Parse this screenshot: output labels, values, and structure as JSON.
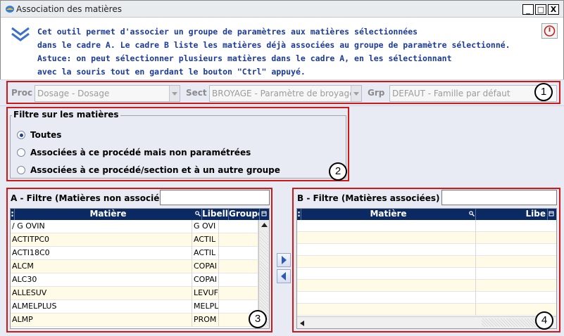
{
  "window": {
    "title": "Association des matières",
    "minimize": "_",
    "maximize": "□",
    "close": "X"
  },
  "info": {
    "lines": [
      "Cet outil permet d'associer un groupe de paramètres aux matières sélectionnées",
      "dans le cadre A. Le cadre B liste les matières déjà associées au groupe de paramètre sélectionné.",
      "Astuce: on peut sélectionner plusieurs matières dans le cadre A, en les sélectionnant",
      "avec la souris tout en gardant le bouton \"Ctrl\" appuyé."
    ]
  },
  "filterbar": {
    "proc_label": "Proc",
    "proc_value": "Dosage - Dosage",
    "sect_label": "Sect",
    "sect_value": "BROYAGE - Paramètre de broyage",
    "grp_label": "Grp",
    "grp_value": "DEFAUT - Famille par défaut",
    "marker": "1"
  },
  "filter_section": {
    "legend": "Filtre sur les matières",
    "options": [
      {
        "label": "Toutes",
        "checked": true
      },
      {
        "label": "Associées à ce procédé mais non paramétrées",
        "checked": false
      },
      {
        "label": "Associées à ce procédé/section et à un autre groupe",
        "checked": false
      }
    ],
    "marker": "2"
  },
  "panel_a": {
    "title": "A - Filtre (Matières non associées)",
    "filter_value": "",
    "columns": [
      "Matière",
      "Libell",
      "Groupe"
    ],
    "rows": [
      {
        "matiere": "/ G OVIN",
        "libelle": "G OVI"
      },
      {
        "matiere": "ACTITPC0",
        "libelle": "ACTIL"
      },
      {
        "matiere": "ACTI18C0",
        "libelle": "ACTIL"
      },
      {
        "matiere": "ALCM",
        "libelle": "COPAI"
      },
      {
        "matiere": "ALC30",
        "libelle": "COPAI"
      },
      {
        "matiere": "ALLESUV",
        "libelle": "LEVUF"
      },
      {
        "matiere": "ALMELPLUS",
        "libelle": "MELPL"
      },
      {
        "matiere": "ALMP",
        "libelle": "PROM"
      }
    ],
    "marker": "3"
  },
  "panel_b": {
    "title": "B - Filtre (Matières associées)",
    "filter_value": "",
    "columns": [
      "Matière",
      "Libe"
    ],
    "row_count": 8,
    "marker": "4"
  },
  "colors": {
    "header_bg": "#0b2a63",
    "info_text": "#1b3a9c",
    "marker_border": "#d01818",
    "row_alt": "#fffbe6"
  }
}
